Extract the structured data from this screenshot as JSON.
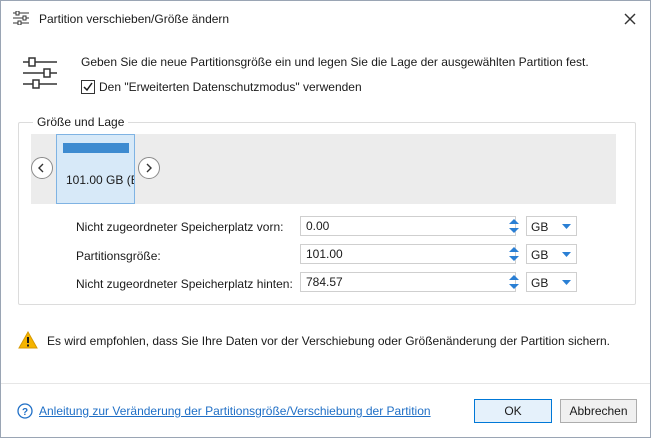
{
  "window": {
    "title": "Partition verschieben/Größe ändern",
    "icon": "sliders-icon",
    "close_icon": "close-icon"
  },
  "intro": {
    "text": "Geben Sie die neue Partitionsgröße ein und legen Sie die Lage der ausgewählten Partition fest.",
    "checkbox_label": "Den \"Erweiterten Datenschutzmodus\" verwenden",
    "checkbox_checked": true
  },
  "group": {
    "title": "Größe und Lage",
    "partition_label": "101.00 GB (E",
    "fields": [
      {
        "label": "Nicht zugeordneter Speicherplatz vorn:",
        "value": "0.00",
        "unit": "GB"
      },
      {
        "label": "Partitionsgröße:",
        "value": "101.00",
        "unit": "GB"
      },
      {
        "label": "Nicht zugeordneter Speicherplatz hinten:",
        "value": "784.57",
        "unit": "GB"
      }
    ]
  },
  "warning": {
    "text": "Es wird empfohlen, dass Sie Ihre Daten vor der Verschiebung oder Größenänderung der Partition sichern."
  },
  "footer": {
    "help_link": "Anleitung zur Veränderung der Partitionsgröße/Verschiebung der Partition",
    "ok_label": "OK",
    "cancel_label": "Abbrechen"
  },
  "colors": {
    "accent": "#0078d7",
    "partition_bar": "#3e8bd0",
    "link": "#1f6fc6",
    "warning": "#f5b400"
  }
}
